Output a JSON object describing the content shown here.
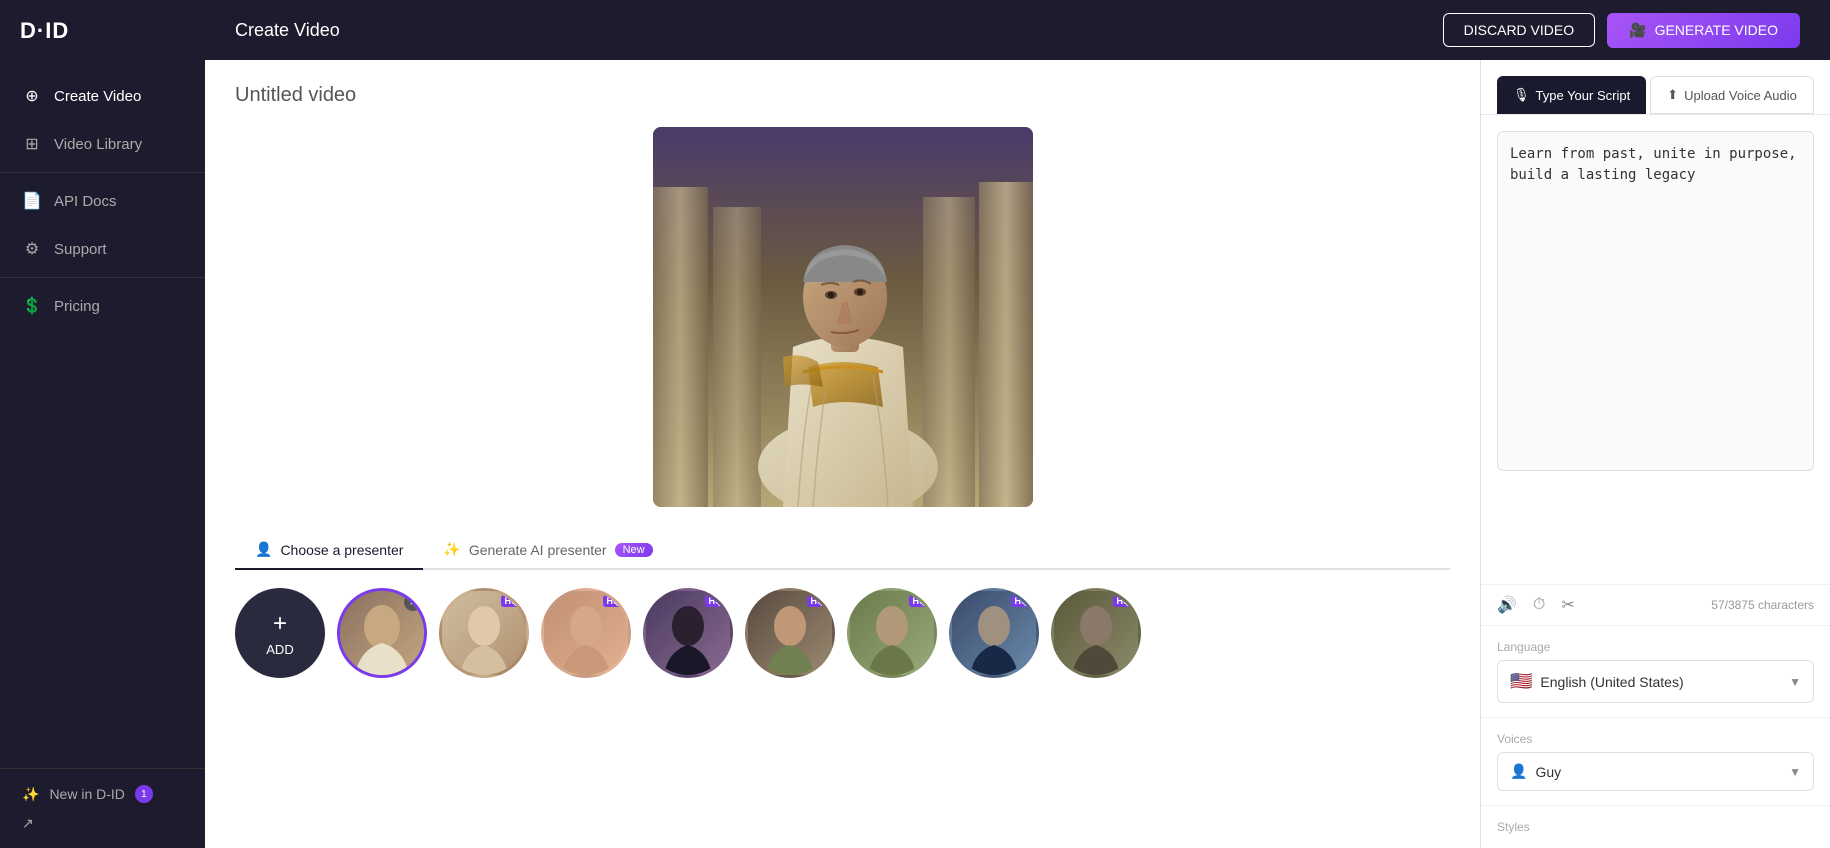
{
  "app": {
    "logo": "D·ID",
    "header_title": "Create Video",
    "discard_label": "DISCARD VIDEO",
    "generate_label": "GENERATE VIDEO"
  },
  "sidebar": {
    "items": [
      {
        "id": "create-video",
        "label": "Create Video",
        "icon": "plus-circle"
      },
      {
        "id": "video-library",
        "label": "Video Library",
        "icon": "grid"
      },
      {
        "id": "api-docs",
        "label": "API Docs",
        "icon": "file-code"
      },
      {
        "id": "support",
        "label": "Support",
        "icon": "settings-circle"
      },
      {
        "id": "pricing",
        "label": "Pricing",
        "icon": "dollar-circle"
      }
    ],
    "bottom": {
      "new_in_did": "New in D-ID",
      "badge_count": "1",
      "share_icon": "share"
    }
  },
  "canvas": {
    "video_title": "Untitled video",
    "presenter_tabs": [
      {
        "id": "choose",
        "label": "Choose a presenter",
        "active": true
      },
      {
        "id": "generate",
        "label": "Generate AI presenter",
        "badge": "New"
      }
    ],
    "presenters": [
      {
        "id": "add",
        "type": "add",
        "label": "ADD"
      },
      {
        "id": "p1",
        "type": "avatar",
        "color": "avatar-1",
        "selected": true,
        "has_remove": true
      },
      {
        "id": "p2",
        "type": "avatar",
        "color": "avatar-2",
        "hq": true
      },
      {
        "id": "p3",
        "type": "avatar",
        "color": "avatar-3",
        "hq": true
      },
      {
        "id": "p4",
        "type": "avatar",
        "color": "avatar-4",
        "hq": true
      },
      {
        "id": "p5",
        "type": "avatar",
        "color": "avatar-5",
        "hq": true
      },
      {
        "id": "p6",
        "type": "avatar",
        "color": "avatar-6",
        "hq": true
      },
      {
        "id": "p7",
        "type": "avatar",
        "color": "avatar-7",
        "hq": true
      },
      {
        "id": "p8",
        "type": "avatar",
        "color": "avatar-8",
        "hq": true
      }
    ]
  },
  "right_panel": {
    "script_tab_active": "Type Your Script",
    "script_tab_inactive": "Upload Voice Audio",
    "script_text": "Learn from past, unite in purpose, build a lasting legacy",
    "char_count": "57/3875 characters",
    "language_label": "Language",
    "language_value": "English (United States)",
    "voices_label": "Voices",
    "voice_value": "Guy",
    "styles_label": "Styles"
  }
}
